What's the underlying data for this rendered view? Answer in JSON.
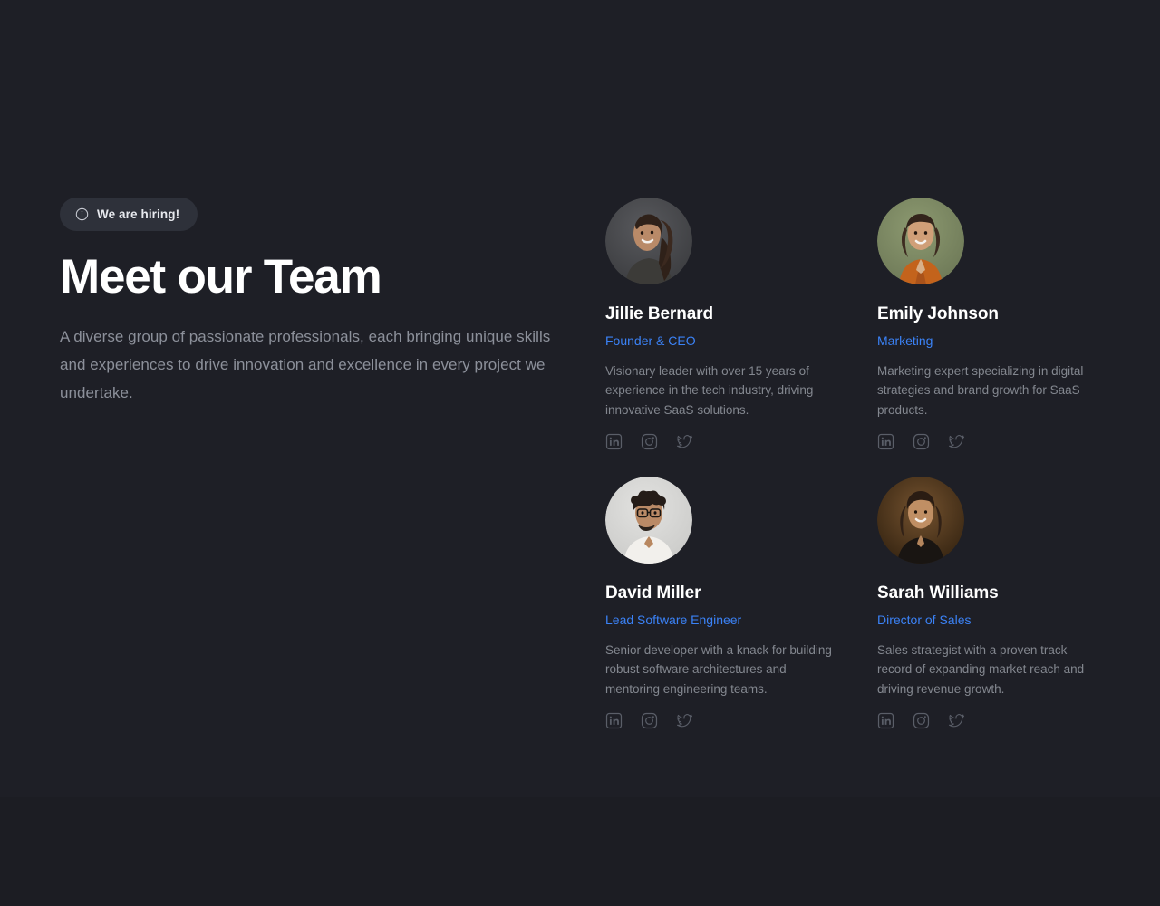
{
  "theme": {
    "background": "#1e1f26",
    "badge_background": "#2e313a",
    "heading_color": "#ffffff",
    "body_text_color": "#8c909a",
    "accent_blue": "#3b82f6",
    "icon_color": "#5a5e68"
  },
  "intro": {
    "badge": {
      "icon": "info-circle-icon",
      "label": "We are hiring!"
    },
    "headline": "Meet our Team",
    "description": "A diverse group of passionate professionals, each bringing unique skills and experiences to drive innovation and excellence in every project we undertake."
  },
  "team": {
    "social_icons": [
      "linkedin-icon",
      "instagram-icon",
      "twitter-icon"
    ],
    "members": [
      {
        "name": "Jillie Bernard",
        "role": "Founder & CEO",
        "bio": "Visionary leader with over 15 years of experience in the tech industry, driving innovative SaaS solutions.",
        "avatar": {
          "alt": "portrait of Jillie Bernard",
          "background": "#4a4c50",
          "skin": "#b98a68",
          "hair": "#2f2119",
          "clothing": "#3c3b38"
        }
      },
      {
        "name": "Emily Johnson",
        "role": "Marketing",
        "bio": "Marketing expert specializing in digital strategies and brand growth for SaaS products.",
        "avatar": {
          "alt": "portrait of Emily Johnson",
          "background": "#7d8a63",
          "skin": "#d09f78",
          "hair": "#33241b",
          "clothing": "#c3631c"
        }
      },
      {
        "name": "David Miller",
        "role": "Lead Software Engineer",
        "bio": "Senior developer with a knack for building robust software architectures and mentoring engineering teams.",
        "avatar": {
          "alt": "portrait of David Miller",
          "background": "#d8d8d6",
          "skin": "#ba8a66",
          "hair": "#241c18",
          "clothing": "#f2f0ec"
        }
      },
      {
        "name": "Sarah Williams",
        "role": "Director of Sales",
        "bio": "Sales strategist with a proven track record of expanding market reach and driving revenue growth.",
        "avatar": {
          "alt": "portrait of Sarah Williams",
          "background": "#5a3f28",
          "skin": "#c08f64",
          "hair": "#2a1c13",
          "clothing": "#191512"
        }
      }
    ]
  }
}
